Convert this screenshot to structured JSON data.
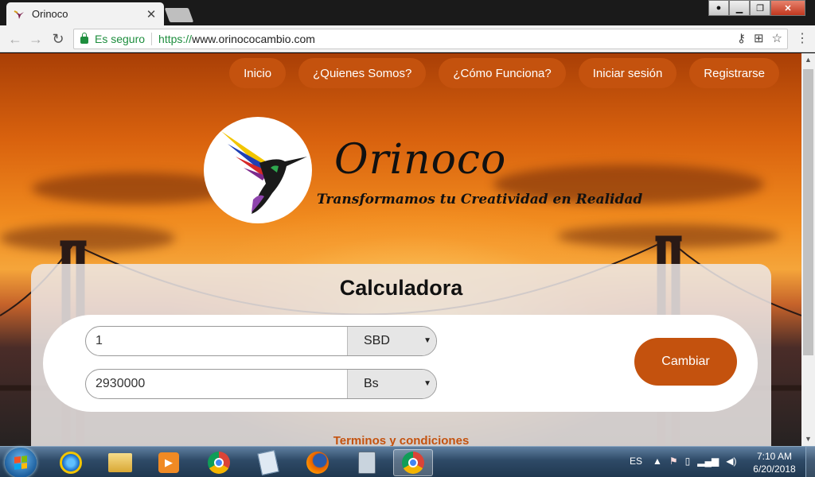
{
  "browser": {
    "tab_title": "Orinoco",
    "tab_close": "✕",
    "secure_label": "Es seguro",
    "url_protocol": "https://",
    "url_host": "www.orinococambio.com",
    "icons": [
      "key-icon",
      "translate-icon",
      "star-icon",
      "menu-icon"
    ]
  },
  "nav": {
    "items": [
      {
        "label": "Inicio"
      },
      {
        "label": "¿Quienes Somos?"
      },
      {
        "label": "¿Cómo Funciona?"
      },
      {
        "label": "Iniciar sesión"
      },
      {
        "label": "Registrarse"
      }
    ]
  },
  "brand": {
    "name": "Orinoco",
    "tagline": "Transformamos tu Creatividad en Realidad"
  },
  "calculator": {
    "title": "Calculadora",
    "from_value": "1",
    "from_currency": "SBD",
    "to_value": "2930000",
    "to_currency": "Bs",
    "button_label": "Cambiar",
    "terms_link": "Terminos y condiciones"
  },
  "colors": {
    "accent": "#c4520e",
    "secure_green": "#1e8e3e"
  },
  "taskbar": {
    "language": "ES",
    "time": "7:10 AM",
    "date": "6/20/2018",
    "apps": [
      "internet-explorer-icon",
      "file-explorer-icon",
      "media-player-icon",
      "chrome-icon",
      "notepad-icon",
      "firefox-icon",
      "calculator-icon",
      "chrome-icon"
    ]
  }
}
